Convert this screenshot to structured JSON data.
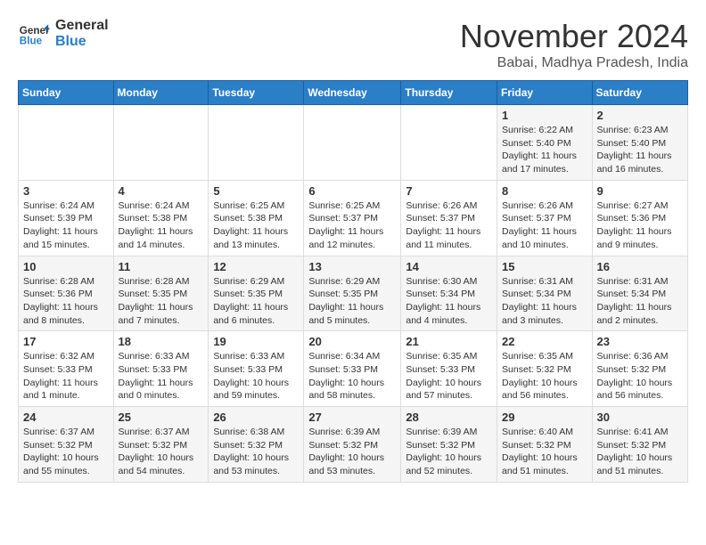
{
  "header": {
    "logo_line1": "General",
    "logo_line2": "Blue",
    "month_title": "November 2024",
    "location": "Babai, Madhya Pradesh, India"
  },
  "weekdays": [
    "Sunday",
    "Monday",
    "Tuesday",
    "Wednesday",
    "Thursday",
    "Friday",
    "Saturday"
  ],
  "weeks": [
    [
      {
        "day": "",
        "content": ""
      },
      {
        "day": "",
        "content": ""
      },
      {
        "day": "",
        "content": ""
      },
      {
        "day": "",
        "content": ""
      },
      {
        "day": "",
        "content": ""
      },
      {
        "day": "1",
        "content": "Sunrise: 6:22 AM\nSunset: 5:40 PM\nDaylight: 11 hours and 17 minutes."
      },
      {
        "day": "2",
        "content": "Sunrise: 6:23 AM\nSunset: 5:40 PM\nDaylight: 11 hours and 16 minutes."
      }
    ],
    [
      {
        "day": "3",
        "content": "Sunrise: 6:24 AM\nSunset: 5:39 PM\nDaylight: 11 hours and 15 minutes."
      },
      {
        "day": "4",
        "content": "Sunrise: 6:24 AM\nSunset: 5:38 PM\nDaylight: 11 hours and 14 minutes."
      },
      {
        "day": "5",
        "content": "Sunrise: 6:25 AM\nSunset: 5:38 PM\nDaylight: 11 hours and 13 minutes."
      },
      {
        "day": "6",
        "content": "Sunrise: 6:25 AM\nSunset: 5:37 PM\nDaylight: 11 hours and 12 minutes."
      },
      {
        "day": "7",
        "content": "Sunrise: 6:26 AM\nSunset: 5:37 PM\nDaylight: 11 hours and 11 minutes."
      },
      {
        "day": "8",
        "content": "Sunrise: 6:26 AM\nSunset: 5:37 PM\nDaylight: 11 hours and 10 minutes."
      },
      {
        "day": "9",
        "content": "Sunrise: 6:27 AM\nSunset: 5:36 PM\nDaylight: 11 hours and 9 minutes."
      }
    ],
    [
      {
        "day": "10",
        "content": "Sunrise: 6:28 AM\nSunset: 5:36 PM\nDaylight: 11 hours and 8 minutes."
      },
      {
        "day": "11",
        "content": "Sunrise: 6:28 AM\nSunset: 5:35 PM\nDaylight: 11 hours and 7 minutes."
      },
      {
        "day": "12",
        "content": "Sunrise: 6:29 AM\nSunset: 5:35 PM\nDaylight: 11 hours and 6 minutes."
      },
      {
        "day": "13",
        "content": "Sunrise: 6:29 AM\nSunset: 5:35 PM\nDaylight: 11 hours and 5 minutes."
      },
      {
        "day": "14",
        "content": "Sunrise: 6:30 AM\nSunset: 5:34 PM\nDaylight: 11 hours and 4 minutes."
      },
      {
        "day": "15",
        "content": "Sunrise: 6:31 AM\nSunset: 5:34 PM\nDaylight: 11 hours and 3 minutes."
      },
      {
        "day": "16",
        "content": "Sunrise: 6:31 AM\nSunset: 5:34 PM\nDaylight: 11 hours and 2 minutes."
      }
    ],
    [
      {
        "day": "17",
        "content": "Sunrise: 6:32 AM\nSunset: 5:33 PM\nDaylight: 11 hours and 1 minute."
      },
      {
        "day": "18",
        "content": "Sunrise: 6:33 AM\nSunset: 5:33 PM\nDaylight: 11 hours and 0 minutes."
      },
      {
        "day": "19",
        "content": "Sunrise: 6:33 AM\nSunset: 5:33 PM\nDaylight: 10 hours and 59 minutes."
      },
      {
        "day": "20",
        "content": "Sunrise: 6:34 AM\nSunset: 5:33 PM\nDaylight: 10 hours and 58 minutes."
      },
      {
        "day": "21",
        "content": "Sunrise: 6:35 AM\nSunset: 5:33 PM\nDaylight: 10 hours and 57 minutes."
      },
      {
        "day": "22",
        "content": "Sunrise: 6:35 AM\nSunset: 5:32 PM\nDaylight: 10 hours and 56 minutes."
      },
      {
        "day": "23",
        "content": "Sunrise: 6:36 AM\nSunset: 5:32 PM\nDaylight: 10 hours and 56 minutes."
      }
    ],
    [
      {
        "day": "24",
        "content": "Sunrise: 6:37 AM\nSunset: 5:32 PM\nDaylight: 10 hours and 55 minutes."
      },
      {
        "day": "25",
        "content": "Sunrise: 6:37 AM\nSunset: 5:32 PM\nDaylight: 10 hours and 54 minutes."
      },
      {
        "day": "26",
        "content": "Sunrise: 6:38 AM\nSunset: 5:32 PM\nDaylight: 10 hours and 53 minutes."
      },
      {
        "day": "27",
        "content": "Sunrise: 6:39 AM\nSunset: 5:32 PM\nDaylight: 10 hours and 53 minutes."
      },
      {
        "day": "28",
        "content": "Sunrise: 6:39 AM\nSunset: 5:32 PM\nDaylight: 10 hours and 52 minutes."
      },
      {
        "day": "29",
        "content": "Sunrise: 6:40 AM\nSunset: 5:32 PM\nDaylight: 10 hours and 51 minutes."
      },
      {
        "day": "30",
        "content": "Sunrise: 6:41 AM\nSunset: 5:32 PM\nDaylight: 10 hours and 51 minutes."
      }
    ]
  ]
}
